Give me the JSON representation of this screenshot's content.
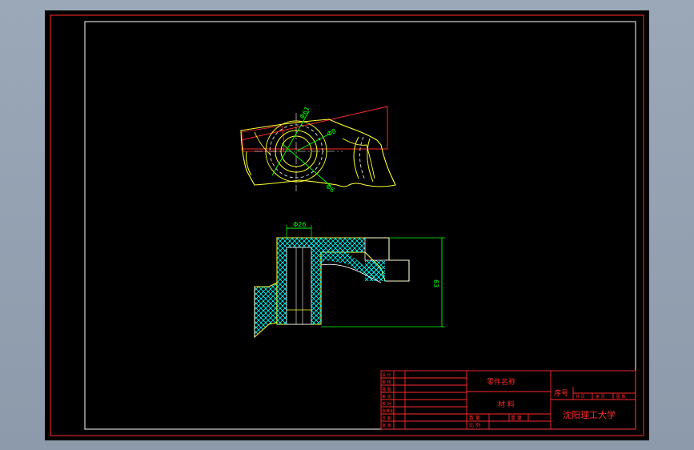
{
  "colors": {
    "background": "#000000",
    "frame": "#ff2a2a",
    "inner_border": "#ffffff",
    "part_outline": "#ffff33",
    "dimension": "#00ff00",
    "hatch": "#00ffff",
    "hidden": "#ffffff",
    "title_text": "#ff2a2a"
  },
  "drawing": {
    "top_view": {
      "dimensions": [
        "Φ61",
        "Φ8",
        "Φ6"
      ]
    },
    "front_view": {
      "dimensions": [
        "Φ26",
        "63"
      ]
    }
  },
  "title_block": {
    "part_name": "零件名称",
    "material": "材 料",
    "serial_label": "序号",
    "school": "沈阳理工大学",
    "cells": {
      "scale_label": "比 例",
      "sheets_label": "图 数",
      "sheet_label": "共 页",
      "page_label": "第 页",
      "weight_label": "重 量",
      "count_label": "件 数",
      "c1": "数 量",
      "c2": "重 量",
      "row_labels": [
        "设 计",
        "审 核",
        "描 图",
        "审 定",
        "校 对",
        "标准化",
        "日 期",
        "批 准"
      ]
    }
  }
}
